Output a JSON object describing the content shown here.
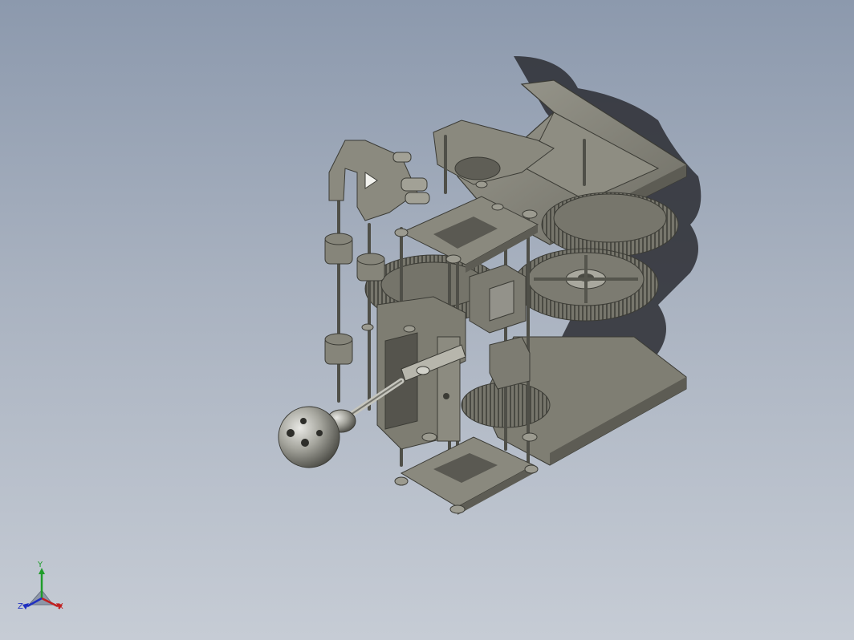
{
  "viewport": {
    "background_top": "#8c99ad",
    "background_bottom": "#c6ccd5"
  },
  "model": {
    "material_color": "#807f74",
    "material_shadow": "#5a5a52",
    "material_highlight": "#b8b8ad",
    "shadow_color": "#2b2d33"
  },
  "triad": {
    "x_label": "X",
    "y_label": "Y",
    "z_label": "Z",
    "x_color": "#c02020",
    "y_color": "#1f9d2a",
    "z_color": "#2030c0"
  }
}
